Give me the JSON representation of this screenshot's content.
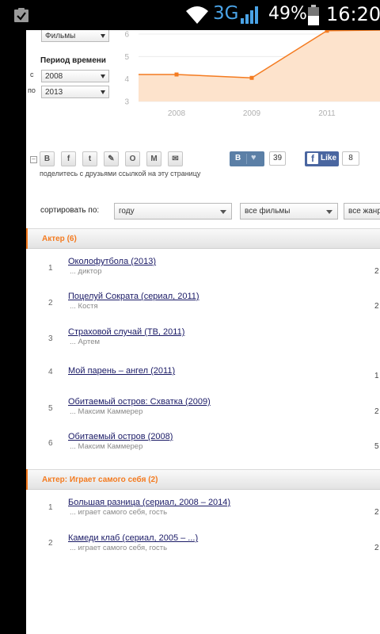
{
  "statusbar": {
    "network": "3G",
    "battery_pct": "49%",
    "time": "16:20"
  },
  "filters": {
    "type_value": "Фильмы",
    "period_label": "Период времени",
    "from_label": "с",
    "from_value": "2008",
    "to_label": "по",
    "to_value": "2013"
  },
  "chart_data": {
    "type": "area",
    "x": [
      "2008",
      "2009",
      "2011"
    ],
    "y": [
      4.2,
      4.05,
      6.15
    ],
    "y_ticks": [
      "3",
      "4",
      "5",
      "6"
    ],
    "ylim": [
      3,
      6
    ],
    "color": "#f47b20",
    "fill": "#fde3cc"
  },
  "share": {
    "text": "поделитесь с друзьями ссылкой на эту страницу",
    "icons": [
      "В",
      "f",
      "t",
      "✎",
      "О",
      "М",
      "✉"
    ],
    "vk_label": "В",
    "vk_count": "39",
    "fb_label": "Like",
    "fb_count": "8"
  },
  "sort": {
    "label": "сортировать по:",
    "by": "году",
    "films": "все фильмы",
    "genres": "все жанры"
  },
  "sections": [
    {
      "title": "Актер (6)",
      "rows": [
        {
          "num": "1",
          "title": "Околофутбола (2013)",
          "role": "... диктор",
          "right": "2"
        },
        {
          "num": "2",
          "title": "Поцелуй Сократа (сериал, 2011)",
          "role": "... Костя",
          "right": "2"
        },
        {
          "num": "3",
          "title": "Страховой случай (ТВ, 2011)",
          "role": "... Артем",
          "right": ""
        },
        {
          "num": "4",
          "title": "Мой парень – ангел (2011)",
          "role": "",
          "right": "1"
        },
        {
          "num": "5",
          "title": "Обитаемый остров: Схватка (2009)",
          "role": "... Максим Каммерер",
          "right": "2"
        },
        {
          "num": "6",
          "title": "Обитаемый остров (2008)",
          "role": "... Максим Каммерер",
          "right": "5"
        }
      ]
    },
    {
      "title": "Актер: Играет самого себя (2)",
      "rows": [
        {
          "num": "1",
          "title": "Большая разница (сериал, 2008 – 2014)",
          "role": "... играет самого себя, гость",
          "right": "2"
        },
        {
          "num": "2",
          "title": "Камеди клаб (сериал, 2005 – ...)",
          "role": "... играет самого себя, гость",
          "right": "2"
        }
      ]
    }
  ]
}
